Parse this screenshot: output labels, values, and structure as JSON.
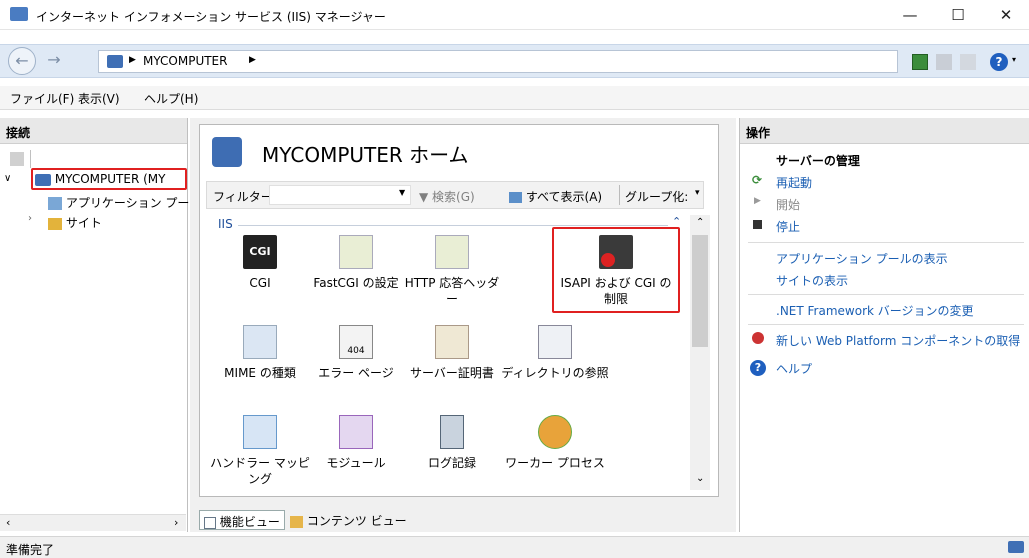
{
  "window": {
    "title": "インターネット インフォメーション サービス (IIS) マネージャー",
    "minimize": "—",
    "maximize": "☐",
    "close": "✕"
  },
  "address": {
    "node": "MYCOMPUTER",
    "sep": "▶"
  },
  "menu": [
    "ファイル(F)",
    "表示(V)",
    "ヘルプ(H)"
  ],
  "left": {
    "header": "接続",
    "tree": {
      "root": "MYCOMPUTER (MY",
      "apppools": "アプリケーション プー",
      "sites": "サイト"
    }
  },
  "center": {
    "title": "MYCOMPUTER ホーム",
    "filter_label": "フィルター:",
    "search": "検索(G)",
    "show_all": "すべて表示(A)",
    "group_by": "グループ化:",
    "group": "IIS",
    "features": [
      {
        "label": "CGI"
      },
      {
        "label": "FastCGI の設定"
      },
      {
        "label": "HTTP 応答ヘッダー"
      },
      {
        "label": "ISAPI および CGI の 制限"
      },
      {
        "label": "MIME の種類"
      },
      {
        "label": "エラー ページ"
      },
      {
        "label": "サーバー証明書"
      },
      {
        "label": "ディレクトリの参照"
      },
      {
        "label": "ハンドラー マッピング"
      },
      {
        "label": "モジュール"
      },
      {
        "label": "ログ記録"
      },
      {
        "label": "ワーカー プロセス"
      }
    ],
    "tabs": {
      "features": "機能ビュー",
      "content": "コンテンツ ビュー"
    }
  },
  "right": {
    "header": "操作",
    "manage": "サーバーの管理",
    "restart": "再起動",
    "start": "開始",
    "stop": "停止",
    "app_pools": "アプリケーション プールの表示",
    "sites": "サイトの表示",
    "netfx": ".NET Framework バージョンの変更",
    "webpi": "新しい Web Platform コンポーネントの取得",
    "help": "ヘルプ"
  },
  "status": "準備完了",
  "colors": {
    "highlight": "#e02020",
    "link": "#1b5fb3"
  }
}
